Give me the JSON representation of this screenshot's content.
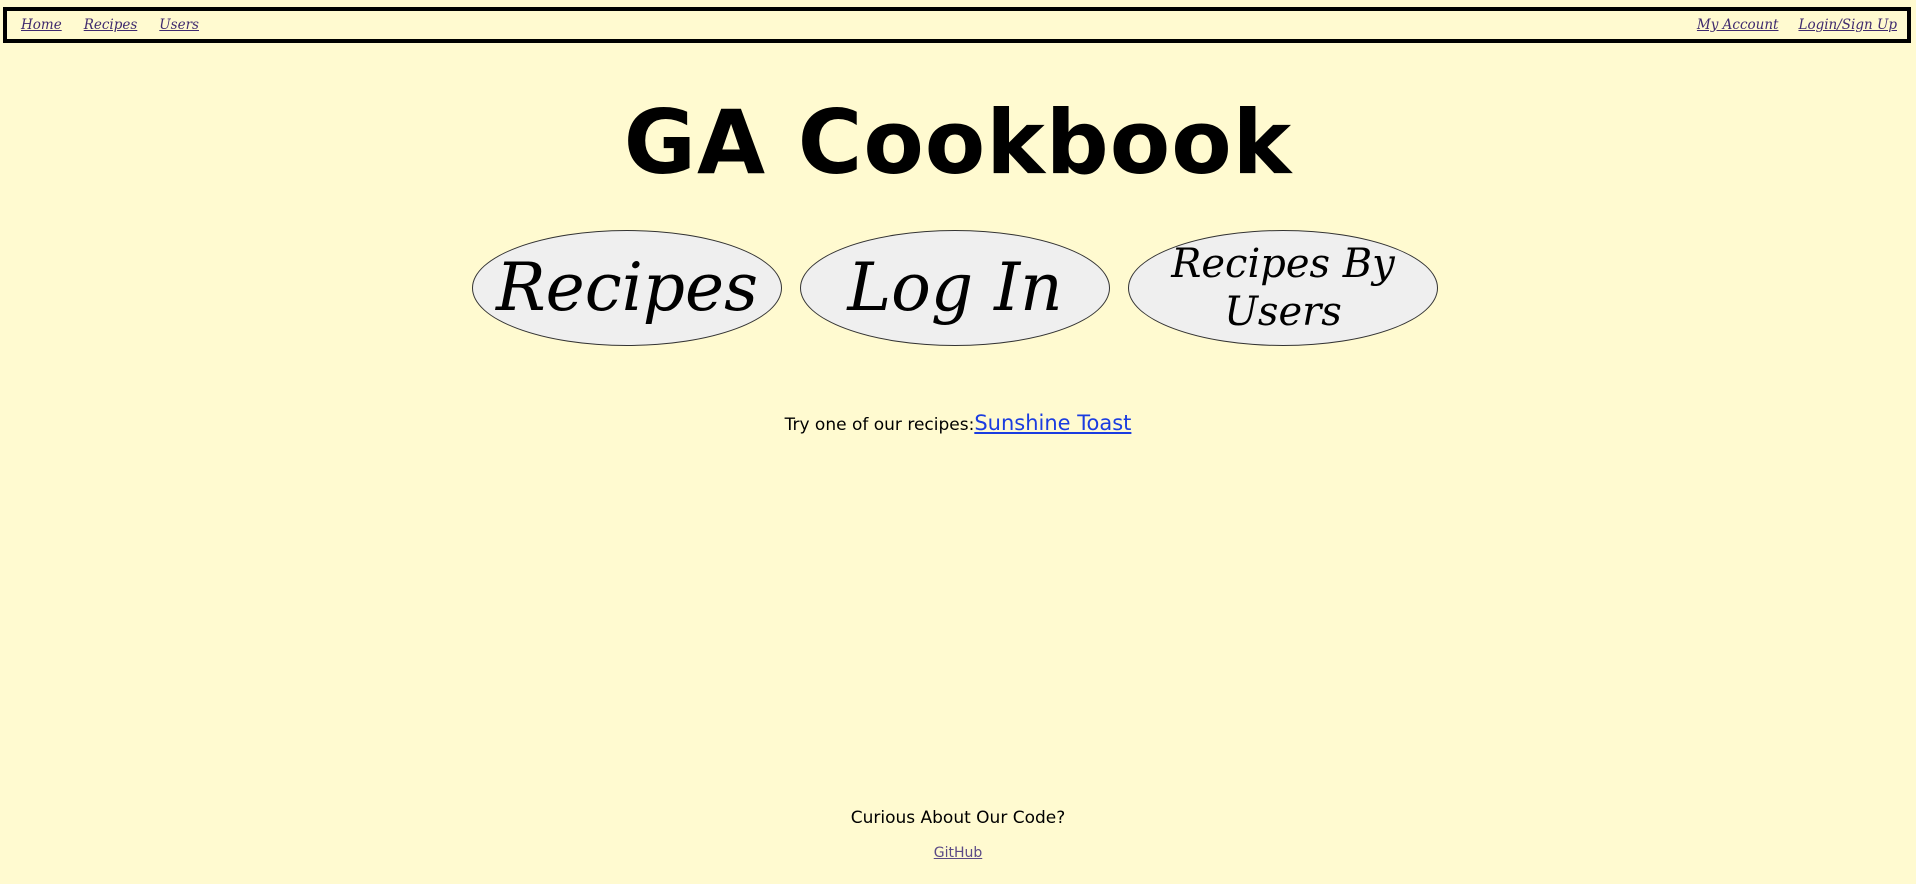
{
  "nav": {
    "left": [
      {
        "label": "Home"
      },
      {
        "label": "Recipes"
      },
      {
        "label": "Users"
      }
    ],
    "right": [
      {
        "label": "My Account"
      },
      {
        "label": "Login/Sign Up"
      }
    ]
  },
  "hero": {
    "title": "GA Cookbook"
  },
  "buttons": {
    "recipes": "Recipes",
    "login": "Log In",
    "recipes_by_users": "Recipes By Users"
  },
  "featured": {
    "prefix": "Try one of our recipes:",
    "recipe_link": "Sunshine Toast"
  },
  "footer": {
    "question": "Curious About Our Code?",
    "github_link": "GitHub"
  },
  "colors": {
    "background": "#fffad0",
    "link_blue": "#1a3ce0",
    "nav_link": "#3f2a6e",
    "oval_fill": "#efefef"
  }
}
